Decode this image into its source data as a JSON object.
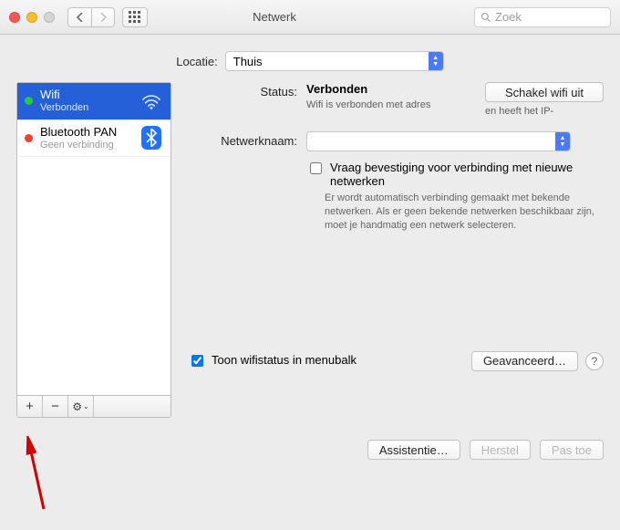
{
  "window": {
    "title": "Netwerk",
    "search_placeholder": "Zoek"
  },
  "location": {
    "label": "Locatie:",
    "value": "Thuis"
  },
  "sidebar": {
    "services": [
      {
        "name": "Wifi",
        "status": "Verbonden",
        "led": "green",
        "kind": "wifi",
        "selected": true
      },
      {
        "name": "Bluetooth PAN",
        "status": "Geen verbinding",
        "led": "red",
        "kind": "bluetooth",
        "selected": false
      }
    ],
    "add_label": "+",
    "remove_label": "−",
    "gear_label": "⚙"
  },
  "panel": {
    "status_label": "Status:",
    "status_value": "Verbonden",
    "status_sub": "Wifi is verbonden met adres",
    "status_sub_right": "en heeft het IP-",
    "wifi_off_button": "Schakel wifi uit",
    "network_name_label": "Netwerknaam:",
    "network_name_value": "",
    "ask_checkbox_label": "Vraag bevestiging voor verbinding met nieuwe netwerken",
    "ask_help": "Er wordt automatisch verbinding gemaakt met bekende netwerken. Als er geen bekende netwerken beschikbaar zijn, moet je handmatig een netwerk selecteren.",
    "menubar_checkbox_label": "Toon wifistatus in menubalk",
    "menubar_checked": true,
    "advanced_button": "Geavanceerd…"
  },
  "bottom": {
    "assist": "Assistentie…",
    "revert": "Herstel",
    "apply": "Pas toe"
  }
}
